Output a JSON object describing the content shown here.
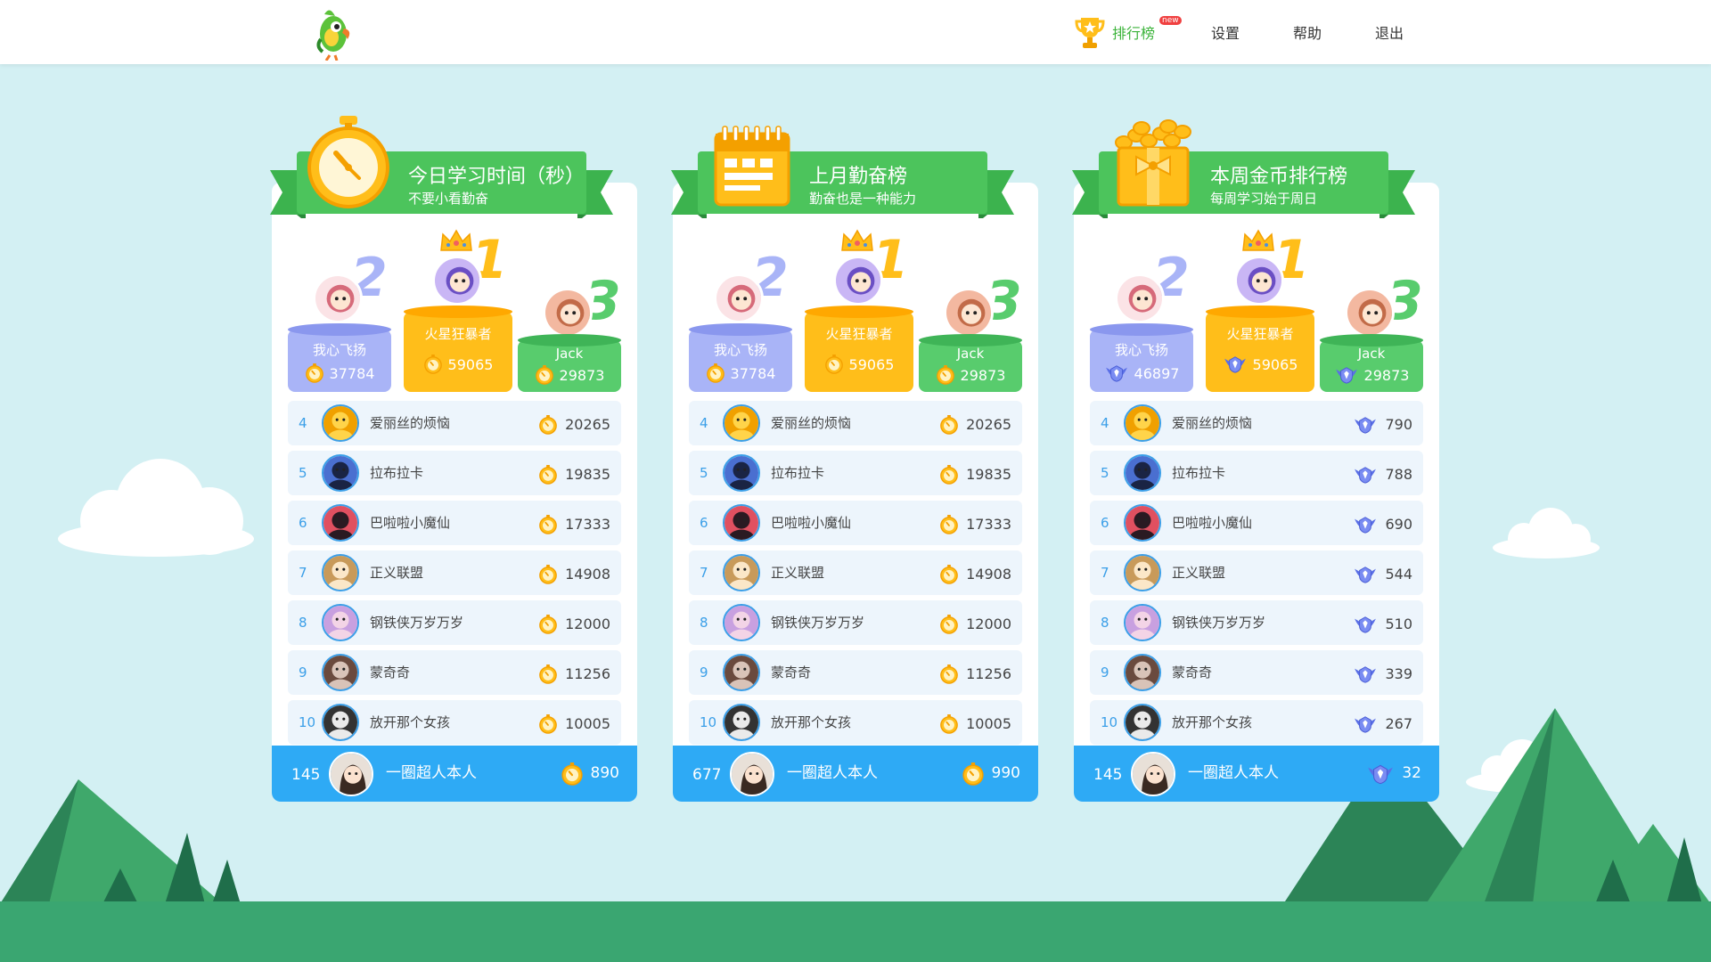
{
  "header": {
    "nav": [
      {
        "label": "排行榜",
        "badge": "new",
        "active": true
      },
      {
        "label": "设置"
      },
      {
        "label": "帮助"
      },
      {
        "label": "退出"
      }
    ]
  },
  "colors": {
    "accent_green": "#4cc45c",
    "blue": "#2eaaf5",
    "gold": "#ffbe1a",
    "silver": "#a9b4f7",
    "bronze": "#58cc6d"
  },
  "panels": [
    {
      "title": "今日学习时间（秒）",
      "subtitle": "不要小看勤奋",
      "icon": "stopwatch-icon",
      "score_icon": "stopwatch-coin-icon",
      "podium": {
        "first": {
          "rank": "1",
          "name": "火星狂暴者",
          "score": "59065"
        },
        "second": {
          "rank": "2",
          "name": "我心飞扬",
          "score": "37784"
        },
        "third": {
          "rank": "3",
          "name": "Jack",
          "score": "29873"
        }
      },
      "rows": [
        {
          "rank": "4",
          "name": "爱丽丝的烦恼",
          "score": "20265"
        },
        {
          "rank": "5",
          "name": "拉布拉卡",
          "score": "19835"
        },
        {
          "rank": "6",
          "name": "巴啦啦小魔仙",
          "score": "17333"
        },
        {
          "rank": "7",
          "name": "正义联盟",
          "score": "14908"
        },
        {
          "rank": "8",
          "name": "钢铁侠万岁万岁",
          "score": "12000"
        },
        {
          "rank": "9",
          "name": "蒙奇奇",
          "score": "11256"
        },
        {
          "rank": "10",
          "name": "放开那个女孩",
          "score": "10005"
        }
      ],
      "me": {
        "rank": "145",
        "name": "一圈超人本人",
        "score": "890"
      }
    },
    {
      "title": "上月勤奋榜",
      "subtitle": "勤奋也是一种能力",
      "icon": "calendar-icon",
      "score_icon": "stopwatch-coin-icon",
      "podium": {
        "first": {
          "rank": "1",
          "name": "火星狂暴者",
          "score": "59065"
        },
        "second": {
          "rank": "2",
          "name": "我心飞扬",
          "score": "37784"
        },
        "third": {
          "rank": "3",
          "name": "Jack",
          "score": "29873"
        }
      },
      "rows": [
        {
          "rank": "4",
          "name": "爱丽丝的烦恼",
          "score": "20265"
        },
        {
          "rank": "5",
          "name": "拉布拉卡",
          "score": "19835"
        },
        {
          "rank": "6",
          "name": "巴啦啦小魔仙",
          "score": "17333"
        },
        {
          "rank": "7",
          "name": "正义联盟",
          "score": "14908"
        },
        {
          "rank": "8",
          "name": "钢铁侠万岁万岁",
          "score": "12000"
        },
        {
          "rank": "9",
          "name": "蒙奇奇",
          "score": "11256"
        },
        {
          "rank": "10",
          "name": "放开那个女孩",
          "score": "10005"
        }
      ],
      "me": {
        "rank": "677",
        "name": "一圈超人本人",
        "score": "990"
      }
    },
    {
      "title": "本周金币排行榜",
      "subtitle": "每周学习始于周日",
      "icon": "gift-coins-icon",
      "score_icon": "wing-badge-icon",
      "podium": {
        "first": {
          "rank": "1",
          "name": "火星狂暴者",
          "score": "59065"
        },
        "second": {
          "rank": "2",
          "name": "我心飞扬",
          "score": "46897"
        },
        "third": {
          "rank": "3",
          "name": "Jack",
          "score": "29873"
        }
      },
      "rows": [
        {
          "rank": "4",
          "name": "爱丽丝的烦恼",
          "score": "790"
        },
        {
          "rank": "5",
          "name": "拉布拉卡",
          "score": "788"
        },
        {
          "rank": "6",
          "name": "巴啦啦小魔仙",
          "score": "690"
        },
        {
          "rank": "7",
          "name": "正义联盟",
          "score": "544"
        },
        {
          "rank": "8",
          "name": "钢铁侠万岁万岁",
          "score": "510"
        },
        {
          "rank": "9",
          "name": "蒙奇奇",
          "score": "339"
        },
        {
          "rank": "10",
          "name": "放开那个女孩",
          "score": "267"
        }
      ],
      "me": {
        "rank": "145",
        "name": "一圈超人本人",
        "score": "32"
      }
    }
  ]
}
